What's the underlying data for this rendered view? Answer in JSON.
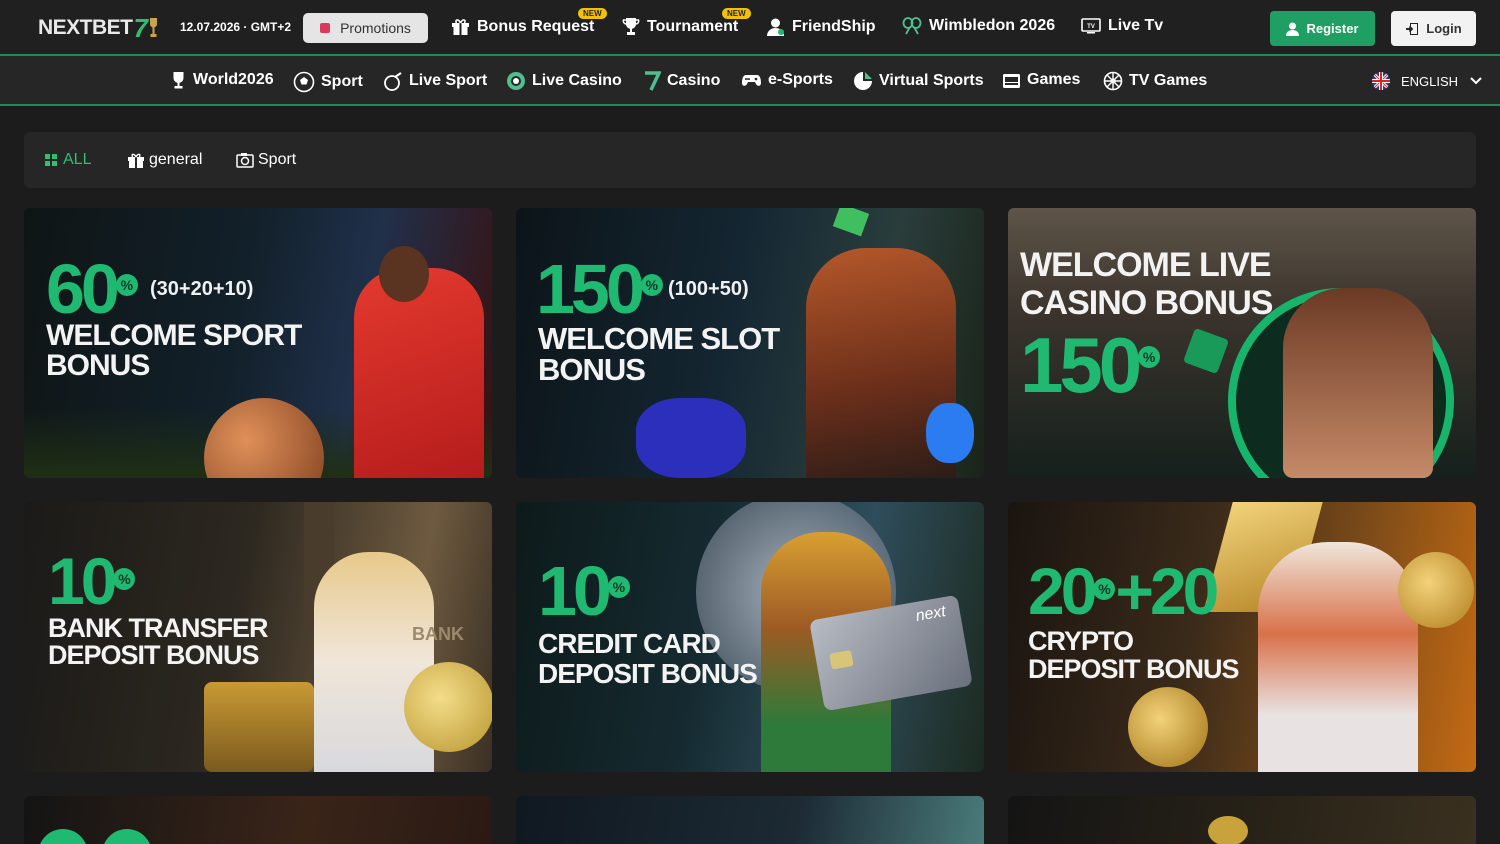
{
  "header": {
    "logo_text": "NEXTBET",
    "logo_seven": "7",
    "datetime": "12.07.2026 · GMT+2",
    "promotions_label": "Promotions",
    "nav": [
      {
        "label": "Bonus Request",
        "badge": "NEW",
        "icon": "gift-icon"
      },
      {
        "label": "Tournament",
        "badge": "NEW",
        "icon": "trophy-icon"
      },
      {
        "label": "FriendShip",
        "icon": "user-icon"
      },
      {
        "label": "Wimbledon 2026",
        "icon": "tennis-icon"
      },
      {
        "label": "Live Tv",
        "icon": "tv-icon"
      }
    ],
    "register_label": "Register",
    "login_label": "Login"
  },
  "subnav": {
    "items": [
      {
        "label": "World2026",
        "icon": "trophy-icon"
      },
      {
        "label": "Sport",
        "icon": "soccer-ball-icon"
      },
      {
        "label": "Live Sport",
        "icon": "live-ball-icon"
      },
      {
        "label": "Live Casino",
        "icon": "chip-icon"
      },
      {
        "label": "Casino",
        "icon": "seven-icon"
      },
      {
        "label": "e-Sports",
        "icon": "gamepad-icon"
      },
      {
        "label": "Virtual Sports",
        "icon": "virtual-icon"
      },
      {
        "label": "Games",
        "icon": "slot-icon"
      },
      {
        "label": "TV Games",
        "icon": "wheel-icon"
      }
    ],
    "language": "ENGLISH"
  },
  "filters": {
    "items": [
      {
        "label": "ALL",
        "active": true,
        "icon": "grid-icon"
      },
      {
        "label": "general",
        "icon": "gift-icon"
      },
      {
        "label": "Sport",
        "icon": "camera-icon"
      }
    ]
  },
  "promotions": [
    {
      "percent": "60",
      "extra": "(30+20+10)",
      "line1": "WELCOME SPORT",
      "line2": "BONUS"
    },
    {
      "percent": "150",
      "extra": "(100+50)",
      "line1": "WELCOME SLOT",
      "line2": "BONUS"
    },
    {
      "percent": "150",
      "pre1": "WELCOME LIVE",
      "pre2": "CASINO BONUS"
    },
    {
      "percent": "10",
      "line1": "BANK TRANSFER",
      "line2": "DEPOSIT BONUS",
      "watermark": "BANK"
    },
    {
      "percent": "10",
      "line1": "CREDIT CARD",
      "line2": "DEPOSIT BONUS",
      "card_brand": "next"
    },
    {
      "percent": "20",
      "plus": "+20",
      "line1": "CRYPTO",
      "line2": "DEPOSIT BONUS"
    }
  ],
  "colors": {
    "accent": "#1fb971",
    "header_bg": "#202020",
    "badge": "#f2c200"
  }
}
